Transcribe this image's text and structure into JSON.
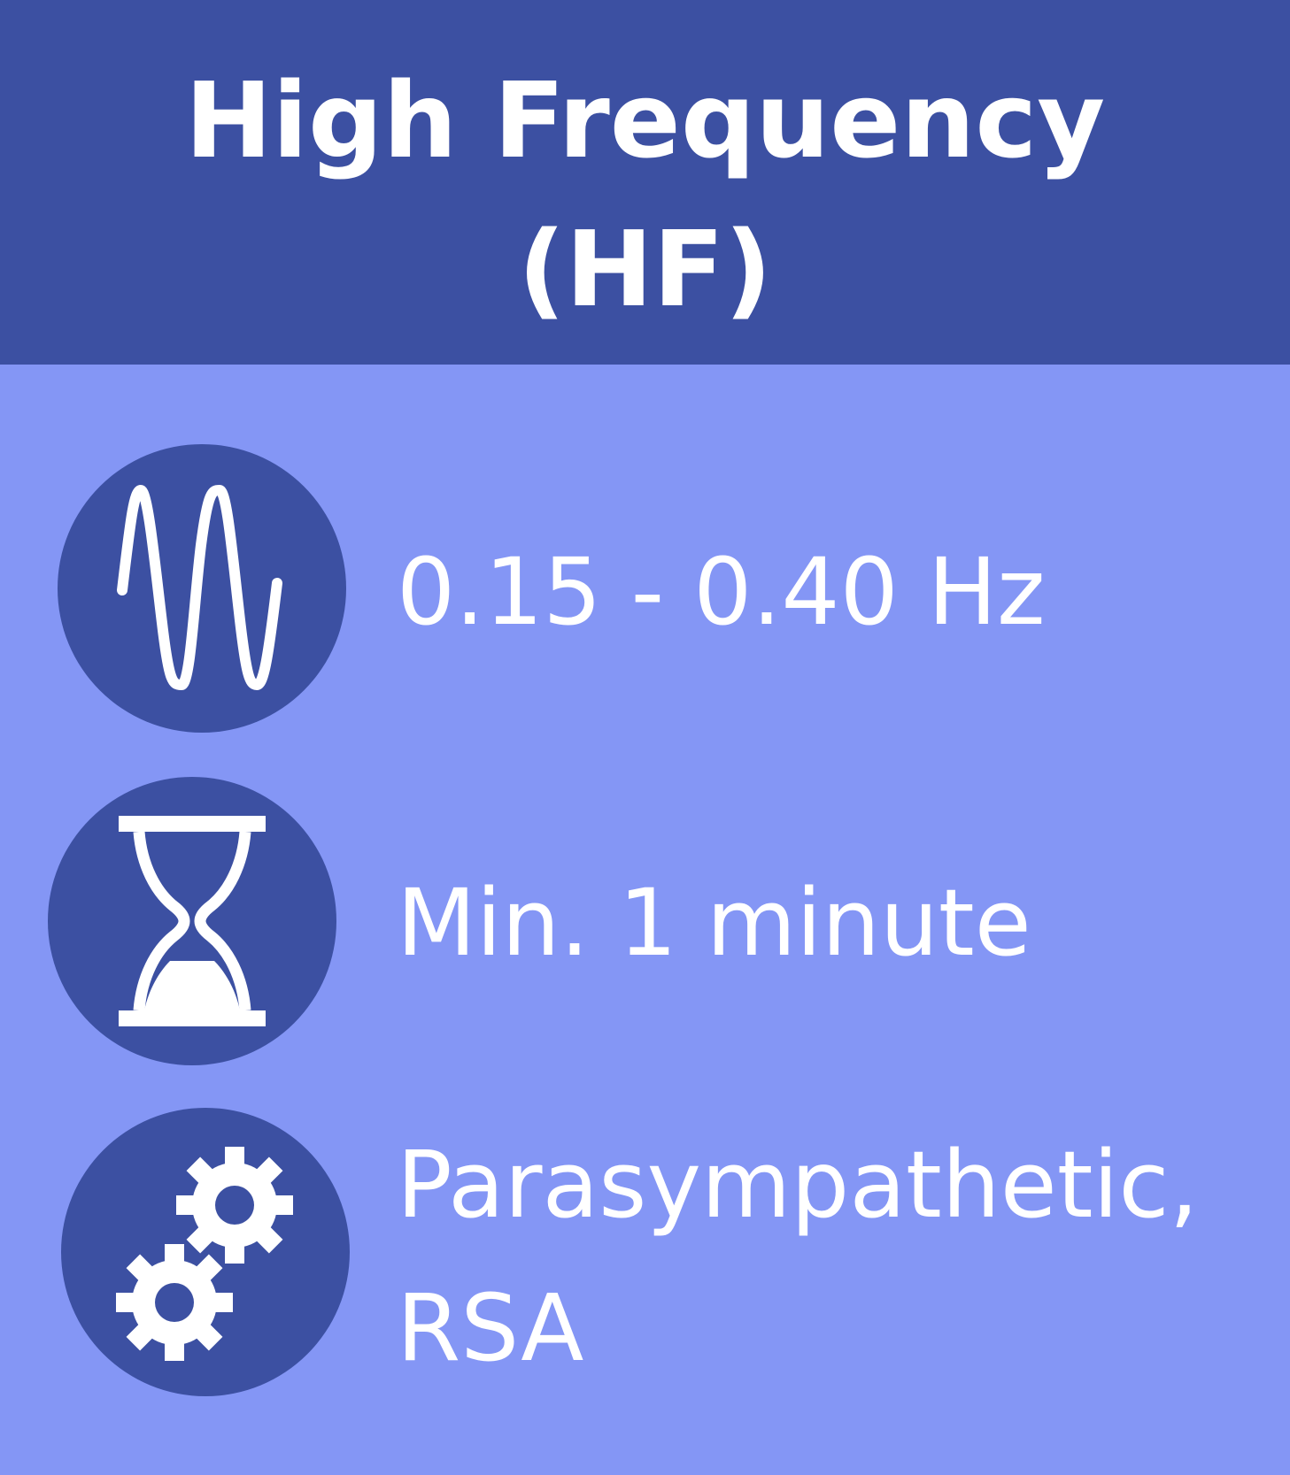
{
  "header": {
    "title_line1": "High Frequency",
    "title_line2": "(HF)"
  },
  "items": [
    {
      "icon": "sine-wave-icon",
      "text": "0.15 - 0.40 Hz"
    },
    {
      "icon": "hourglass-icon",
      "text": "Min. 1 minute"
    },
    {
      "icon": "gears-icon",
      "text_line1": "Parasympathetic,",
      "text_line2": "RSA"
    }
  ],
  "colors": {
    "header_bg": "#3c50a2",
    "body_bg": "#8496f5",
    "icon_circle": "#3c50a2",
    "text": "#ffffff"
  }
}
